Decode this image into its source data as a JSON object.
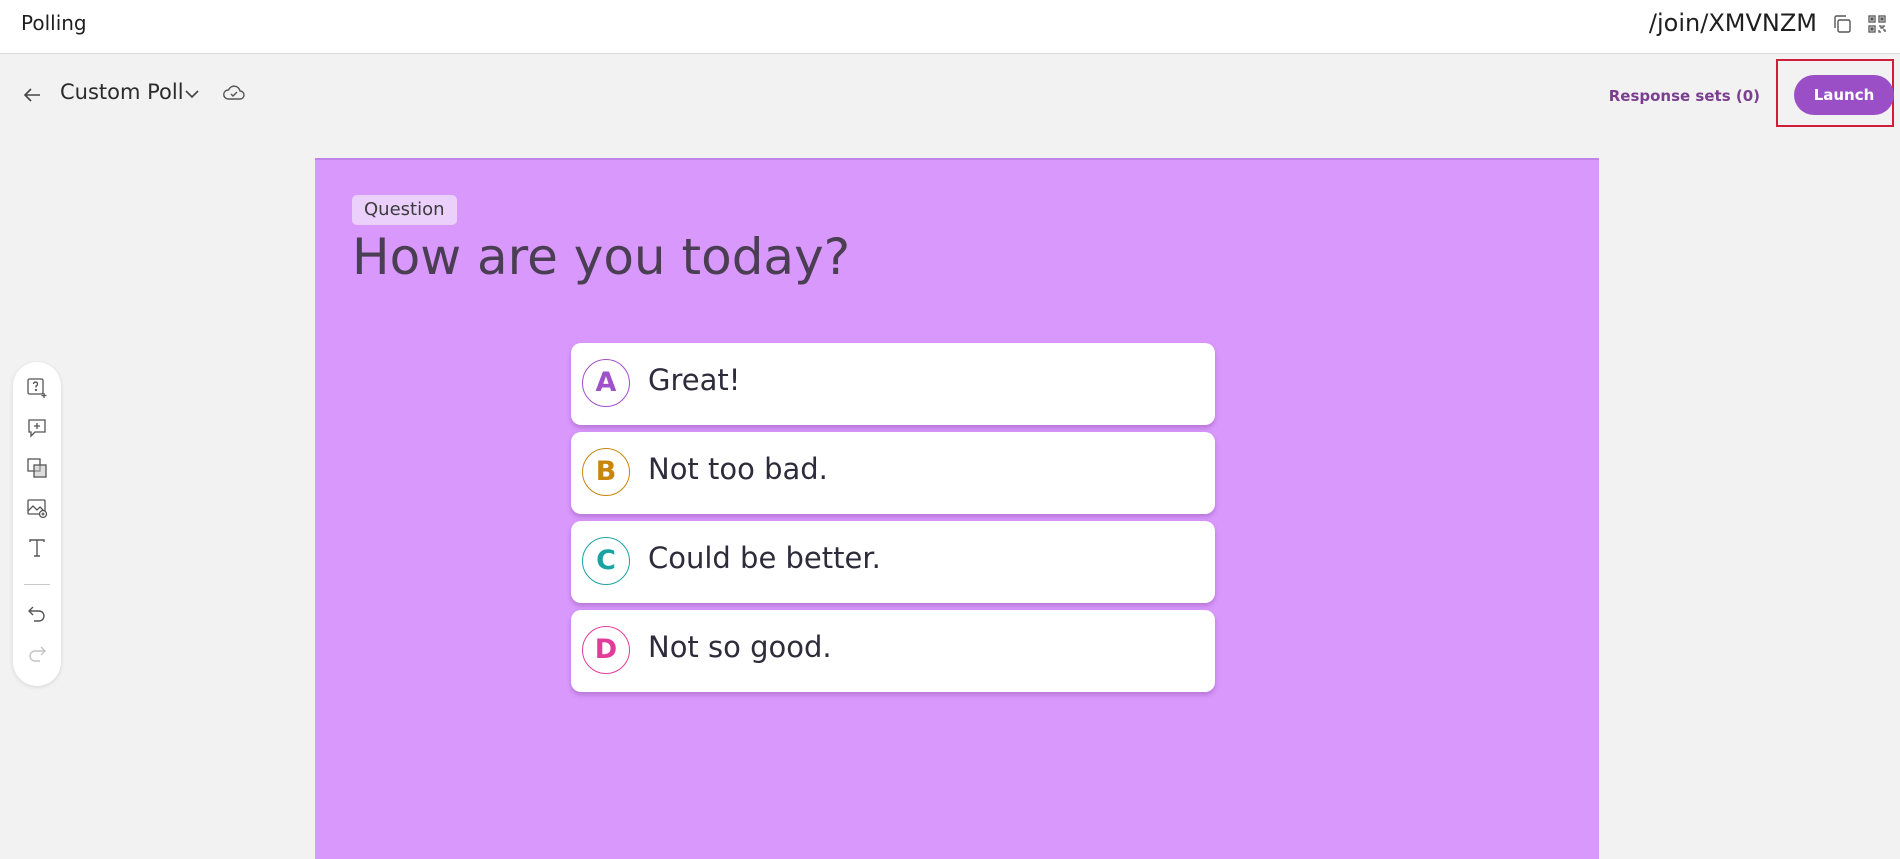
{
  "header": {
    "app_title": "Polling",
    "join_url": "/join/XMVNZM",
    "copy_icon": "copy-icon",
    "qr_icon": "qr-code-icon"
  },
  "poll_bar": {
    "back_icon": "arrow-left-icon",
    "title": "Custom Poll",
    "dropdown_icon": "chevron-down-icon",
    "save_status_icon": "cloud-icon",
    "response_sets_label": "Response sets (0)",
    "launch_label": "Launch"
  },
  "toolbar": {
    "tools": [
      "add-question-icon",
      "add-comment-icon",
      "shapes-icon",
      "image-icon",
      "text-icon"
    ],
    "history": [
      "undo-icon",
      "redo-icon"
    ]
  },
  "slide": {
    "tag": "Question",
    "question": "How are you today?",
    "background": "#d998fc",
    "options": [
      {
        "letter": "A",
        "text": "Great!",
        "color": "#a050c8"
      },
      {
        "letter": "B",
        "text": "Not too bad.",
        "color": "#c8860a"
      },
      {
        "letter": "C",
        "text": "Could be better.",
        "color": "#19a3a3"
      },
      {
        "letter": "D",
        "text": "Not so good.",
        "color": "#e23b9a"
      }
    ]
  },
  "colors": {
    "accent": "#9b4fc7",
    "launch_highlight": "#d01e3a",
    "response_sets_text": "#7a3f8f"
  }
}
